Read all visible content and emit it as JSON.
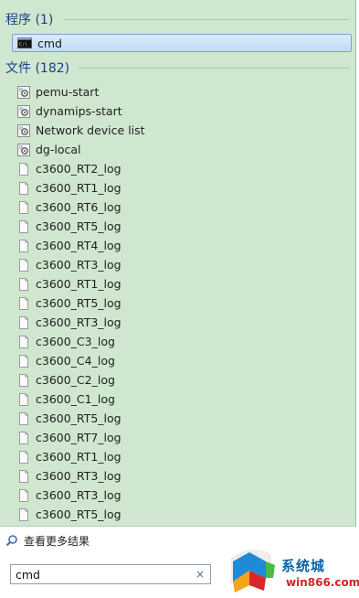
{
  "programs": {
    "header": "程序 (1)",
    "items": [
      {
        "label": "cmd",
        "icon": "console-icon"
      }
    ]
  },
  "files": {
    "header": "文件 (182)",
    "items": [
      {
        "label": "pemu-start",
        "icon": "script-icon"
      },
      {
        "label": "dynamips-start",
        "icon": "script-icon"
      },
      {
        "label": "Network device list",
        "icon": "script-icon"
      },
      {
        "label": "dg-local",
        "icon": "script-icon"
      },
      {
        "label": "c3600_RT2_log",
        "icon": "document-icon"
      },
      {
        "label": "c3600_RT1_log",
        "icon": "document-icon"
      },
      {
        "label": "c3600_RT6_log",
        "icon": "document-icon"
      },
      {
        "label": "c3600_RT5_log",
        "icon": "document-icon"
      },
      {
        "label": "c3600_RT4_log",
        "icon": "document-icon"
      },
      {
        "label": "c3600_RT3_log",
        "icon": "document-icon"
      },
      {
        "label": "c3600_RT1_log",
        "icon": "document-icon"
      },
      {
        "label": "c3600_RT5_log",
        "icon": "document-icon"
      },
      {
        "label": "c3600_RT3_log",
        "icon": "document-icon"
      },
      {
        "label": "c3600_C3_log",
        "icon": "document-icon"
      },
      {
        "label": "c3600_C4_log",
        "icon": "document-icon"
      },
      {
        "label": "c3600_C2_log",
        "icon": "document-icon"
      },
      {
        "label": "c3600_C1_log",
        "icon": "document-icon"
      },
      {
        "label": "c3600_RT5_log",
        "icon": "document-icon"
      },
      {
        "label": "c3600_RT7_log",
        "icon": "document-icon"
      },
      {
        "label": "c3600_RT1_log",
        "icon": "document-icon"
      },
      {
        "label": "c3600_RT3_log",
        "icon": "document-icon"
      },
      {
        "label": "c3600_RT3_log",
        "icon": "document-icon"
      },
      {
        "label": "c3600_RT5_log",
        "icon": "document-icon"
      }
    ]
  },
  "see_more": {
    "label": "查看更多结果",
    "icon": "search-icon"
  },
  "search": {
    "value": "cmd",
    "clear_icon": "close-icon",
    "clear_glyph": "×"
  },
  "watermark": {
    "line1": "系统城",
    "line2": "win866.com"
  },
  "colors": {
    "pane_bg": "#cfe7cf",
    "header_text": "#1e3e8a",
    "selection_border": "#7da2ce"
  }
}
